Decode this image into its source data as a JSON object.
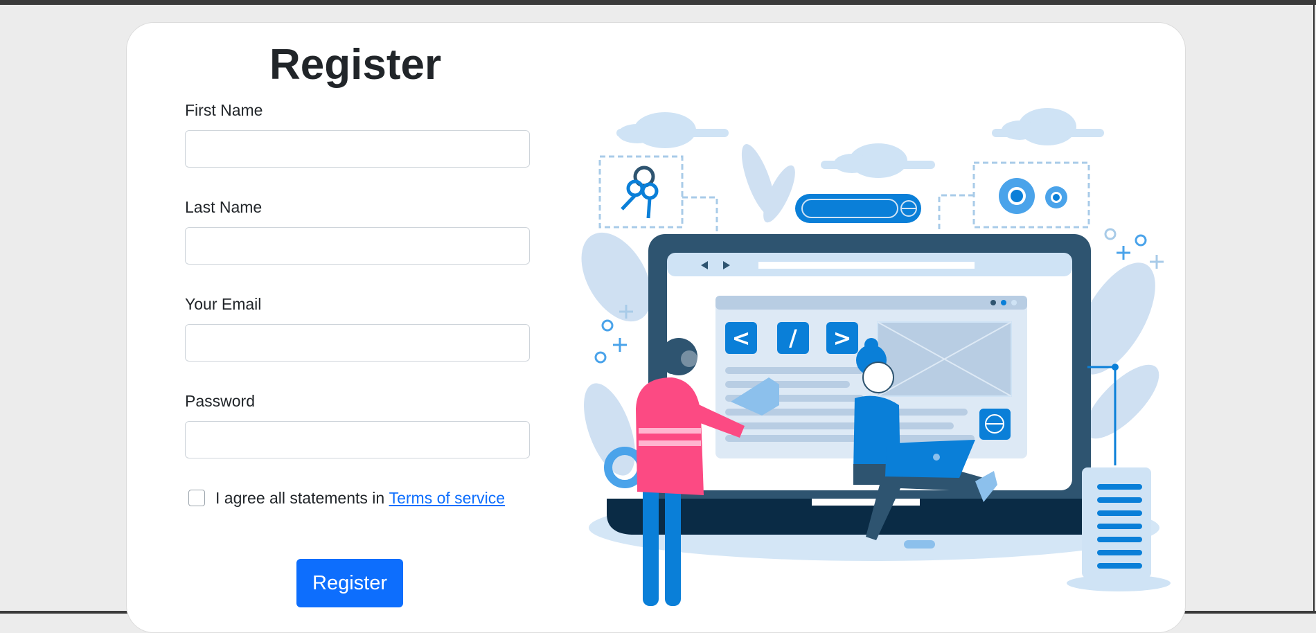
{
  "form": {
    "title": "Register",
    "fields": [
      {
        "label": "First Name",
        "value": "",
        "placeholder": ""
      },
      {
        "label": "Last Name",
        "value": "",
        "placeholder": ""
      },
      {
        "label": "Your Email",
        "value": "",
        "placeholder": ""
      },
      {
        "label": "Password",
        "value": "",
        "placeholder": ""
      }
    ],
    "agree_text": "I agree all statements in ",
    "terms_link": "Terms of service",
    "agree_checked": false,
    "submit_label": "Register"
  },
  "illustration": {
    "code_tags": [
      "<",
      "/",
      ">"
    ]
  },
  "colors": {
    "primary": "#0d6efd",
    "illustration_dark": "#2e5470",
    "illustration_blue": "#0a7fd8",
    "illustration_light": "#cfe3f5",
    "shirt_pink": "#fc4a83"
  }
}
